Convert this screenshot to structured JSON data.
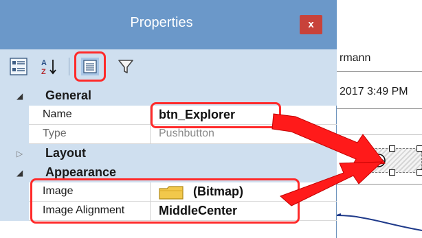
{
  "window": {
    "title": "Properties",
    "close_label": "x"
  },
  "toolbar": {
    "buttons": [
      {
        "name": "categorized",
        "icon": "categorized-icon",
        "active": false
      },
      {
        "name": "alphabetical",
        "icon": "sort-az-icon",
        "active": false
      },
      {
        "name": "properties",
        "icon": "property-pages-icon",
        "active": true
      },
      {
        "name": "events",
        "icon": "filter-icon",
        "active": false
      }
    ]
  },
  "grid": {
    "categories": [
      {
        "label": "General",
        "expanded": true,
        "properties": [
          {
            "name": "Name",
            "value": "btn_Explorer",
            "readonly": false
          },
          {
            "name": "Type",
            "value": "Pushbutton",
            "readonly": true
          }
        ]
      },
      {
        "label": "Layout",
        "expanded": false,
        "properties": []
      },
      {
        "label": "Appearance",
        "expanded": true,
        "properties": [
          {
            "name": "Image",
            "value": "(Bitmap)",
            "icon": "folder-icon",
            "readonly": false
          },
          {
            "name": "Image Alignment",
            "value": "MiddleCenter",
            "readonly": false
          }
        ]
      }
    ]
  },
  "canvas": {
    "text_1": "rmann",
    "text_2": "2017 3:49 PM"
  },
  "colors": {
    "titlebar": "#6b98c9",
    "toolbar": "#cfdfef",
    "highlight": "#ff2a2a",
    "close": "#c8423a"
  }
}
